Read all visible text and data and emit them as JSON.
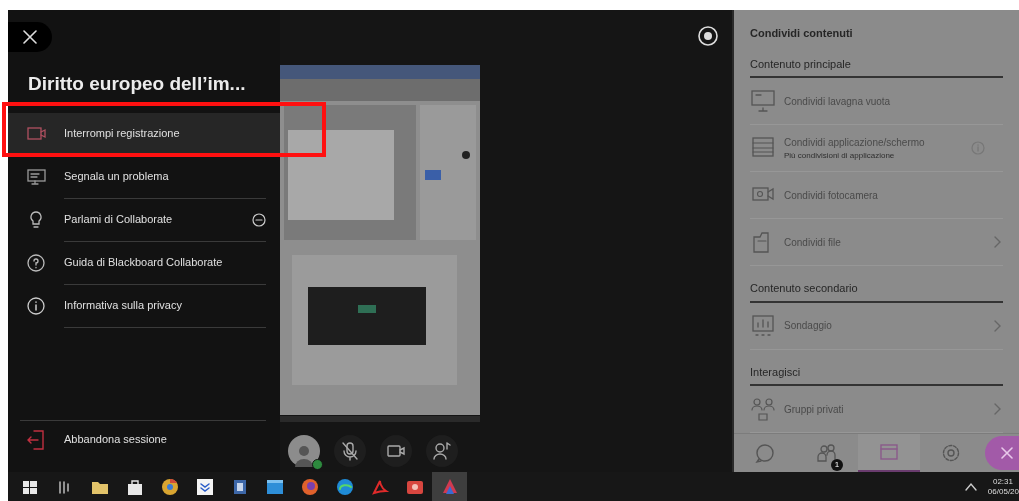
{
  "menu": {
    "title": "Diritto europeo dell’im...",
    "items": [
      {
        "label": "Interrompi registrazione",
        "kind": "record",
        "selected": true,
        "expandable": false
      },
      {
        "label": "Segnala un problema",
        "kind": "report",
        "selected": false,
        "expandable": false
      },
      {
        "label": "Parlami di Collaborate",
        "kind": "bulb",
        "selected": false,
        "expandable": true
      },
      {
        "label": "Guida di Blackboard Collaborate",
        "kind": "help",
        "selected": false,
        "expandable": false
      },
      {
        "label": "Informativa sulla privacy",
        "kind": "info",
        "selected": false,
        "expandable": false
      }
    ],
    "footer_item": {
      "label": "Abbandona sessione"
    }
  },
  "share_panel": {
    "title": "Condividi contenuti",
    "sections": [
      {
        "heading": "Contenuto principale",
        "items": [
          {
            "label": "Condividi lavagna vuota",
            "kind": "whiteboard",
            "chevron": false,
            "info": false
          },
          {
            "label": "Condividi applicazione/schermo",
            "sublabel": "Più condivisioni di applicazione",
            "kind": "app",
            "chevron": false,
            "info": true
          },
          {
            "label": "Condividi fotocamera",
            "kind": "camera",
            "chevron": false,
            "info": false
          },
          {
            "label": "Condividi file",
            "kind": "file",
            "chevron": true,
            "info": false
          }
        ]
      },
      {
        "heading": "Contenuto secondario",
        "items": [
          {
            "label": "Sondaggio",
            "kind": "poll",
            "chevron": true,
            "info": false
          }
        ]
      },
      {
        "heading": "Interagisci",
        "items": [
          {
            "label": "Gruppi privati",
            "kind": "groups",
            "chevron": true,
            "info": false
          }
        ]
      }
    ]
  },
  "bottom_tabs": [
    {
      "kind": "chat",
      "selected": false
    },
    {
      "kind": "people",
      "selected": false,
      "badge": "1"
    },
    {
      "kind": "share",
      "selected": true
    },
    {
      "kind": "settings",
      "selected": false
    },
    {
      "kind": "close",
      "selected": false
    }
  ],
  "taskbar": {
    "apps": [
      {
        "kind": "start",
        "selected": false
      },
      {
        "kind": "taskview",
        "selected": false
      },
      {
        "kind": "folder",
        "selected": false
      },
      {
        "kind": "store",
        "selected": false
      },
      {
        "kind": "chrome",
        "selected": false
      },
      {
        "kind": "dropbox",
        "selected": false
      },
      {
        "kind": "doc",
        "selected": false
      },
      {
        "kind": "window",
        "selected": false
      },
      {
        "kind": "firefox",
        "selected": false
      },
      {
        "kind": "edge",
        "selected": false
      },
      {
        "kind": "pdf",
        "selected": false
      },
      {
        "kind": "media",
        "selected": false
      },
      {
        "kind": "triangle",
        "selected": true
      }
    ],
    "time": "02:31",
    "date": "06/05/20"
  }
}
